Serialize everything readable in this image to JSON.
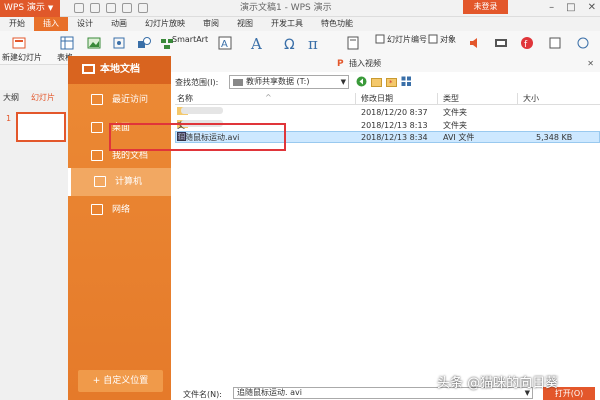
{
  "titlebar": {
    "app_name": "WPS 演示",
    "title": "演示文稿1 - WPS 演示",
    "login": "未登录"
  },
  "tabs": [
    "开始",
    "插入",
    "设计",
    "动画",
    "幻灯片放映",
    "审阅",
    "视图",
    "开发工具",
    "特色功能"
  ],
  "active_tab": "插入",
  "ribbon": {
    "new_slide": "新建幻灯片",
    "smartart": "SmartArt",
    "slide_number": "幻灯片编号",
    "object": "对象",
    "table": "表格"
  },
  "slide_pane": {
    "tab_outline": "大纲",
    "tab_slides": "幻灯片",
    "slide_number": "1"
  },
  "dialog": {
    "title": "插入视频",
    "sidebar_title": "本地文档",
    "nav": [
      {
        "label": "最近访问",
        "icon": "clock-icon"
      },
      {
        "label": "桌面",
        "icon": "desktop-icon"
      },
      {
        "label": "我的文档",
        "icon": "folder-icon"
      },
      {
        "label": "计算机",
        "icon": "computer-icon"
      },
      {
        "label": "网络",
        "icon": "network-icon"
      }
    ],
    "active_nav": "计算机",
    "custom_location": "+ 自定义位置",
    "look_in_label": "查找范围(I):",
    "look_in_value": "教师共享数据 (T:)",
    "columns": {
      "name": "名称",
      "modified": "修改日期",
      "type": "类型",
      "size": "大小"
    },
    "files": [
      {
        "name": "",
        "modified": "2018/12/20 8:37",
        "type": "文件夹",
        "size": ""
      },
      {
        "name": "文",
        "modified": "2018/12/13 8:13",
        "type": "文件夹",
        "size": ""
      },
      {
        "name": "追随鼠标运动.avi",
        "modified": "2018/12/13 8:34",
        "type": "AVI 文件",
        "size": "5,348 KB"
      }
    ],
    "filename_label": "文件名(N):",
    "filename_value": "追随鼠标运动. avi",
    "open_button": "打开(O)"
  },
  "watermark": "头条 @猫咪的向日葵",
  "colors": {
    "accent": "#e3572b",
    "sidebar": "#e8802e",
    "selection": "#cde8ff",
    "highlight_box": "#e0353a"
  }
}
